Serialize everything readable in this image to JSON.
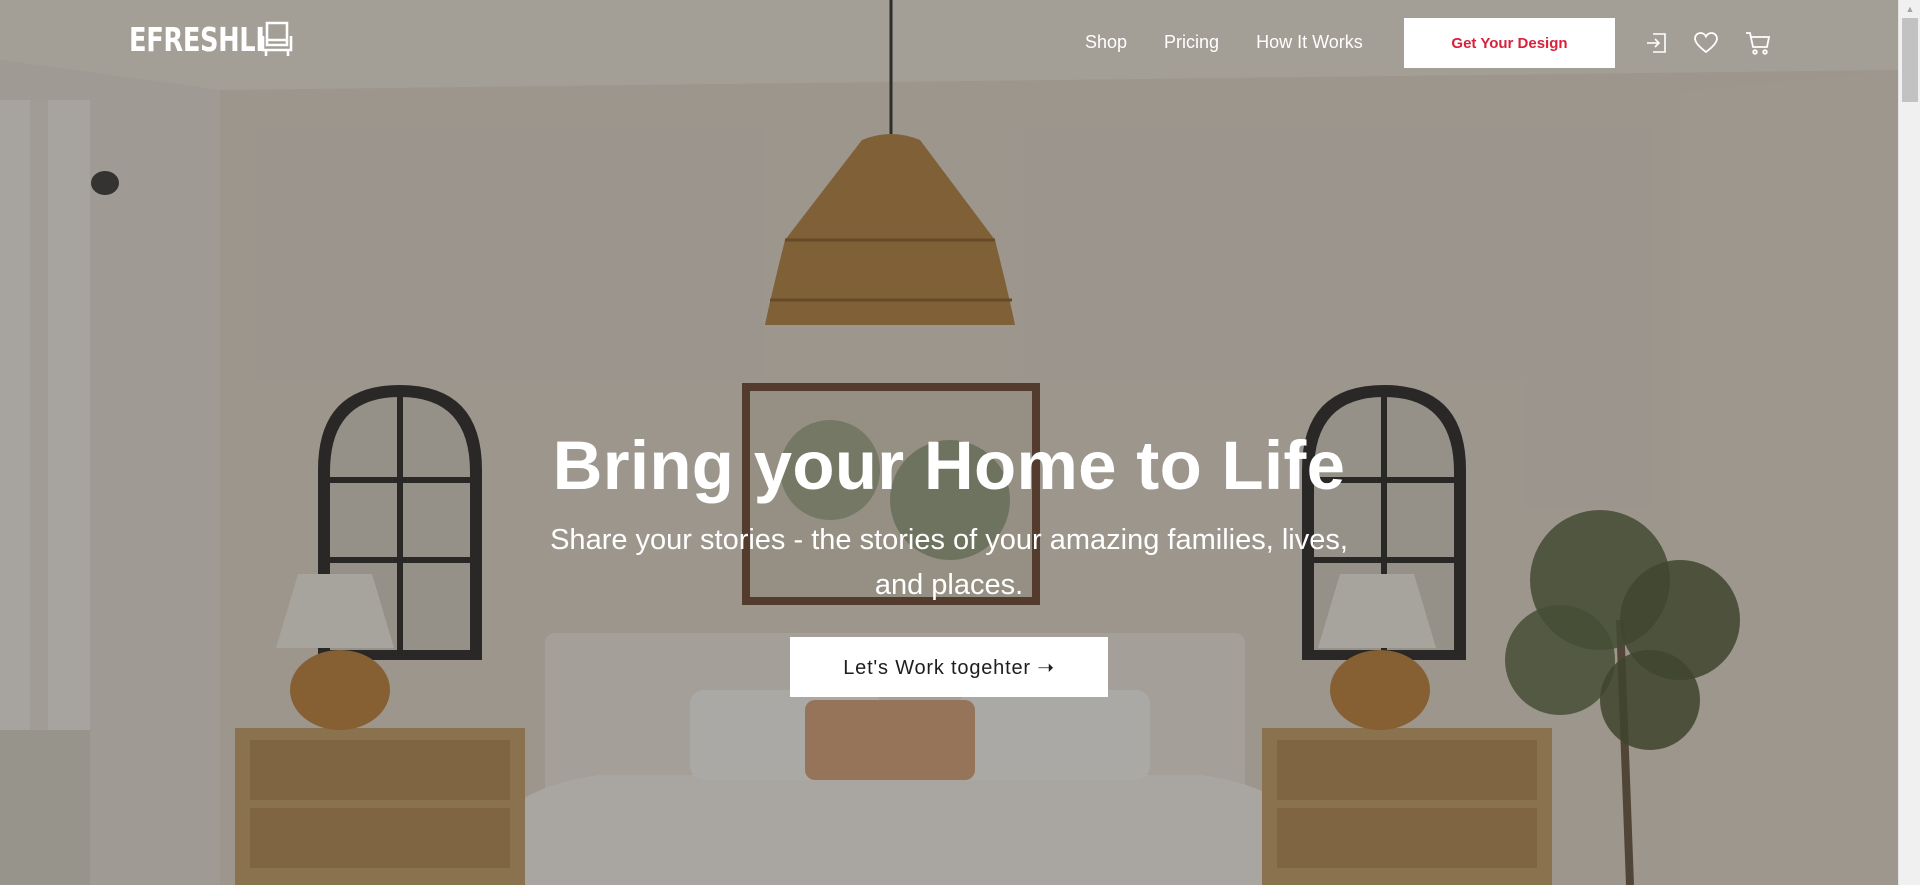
{
  "brand": {
    "name": "EFRESHLI",
    "logo_icon": "armchair-icon"
  },
  "nav": {
    "links": [
      {
        "label": "Shop"
      },
      {
        "label": "Pricing"
      },
      {
        "label": "How It Works"
      }
    ],
    "cta_label": "Get Your Design",
    "icons": [
      "login-icon",
      "heart-icon",
      "cart-icon"
    ]
  },
  "hero": {
    "title": "Bring your Home to Life",
    "subtitle": "Share your stories - the stories of your amazing families, lives, and places.",
    "cta_label": "Let's Work togehter ➝",
    "background": "bedroom-scene-image"
  },
  "colors": {
    "accent": "#d7223a",
    "overlay": "rgba(40,36,32,0.38)",
    "text_light": "#ffffff"
  }
}
